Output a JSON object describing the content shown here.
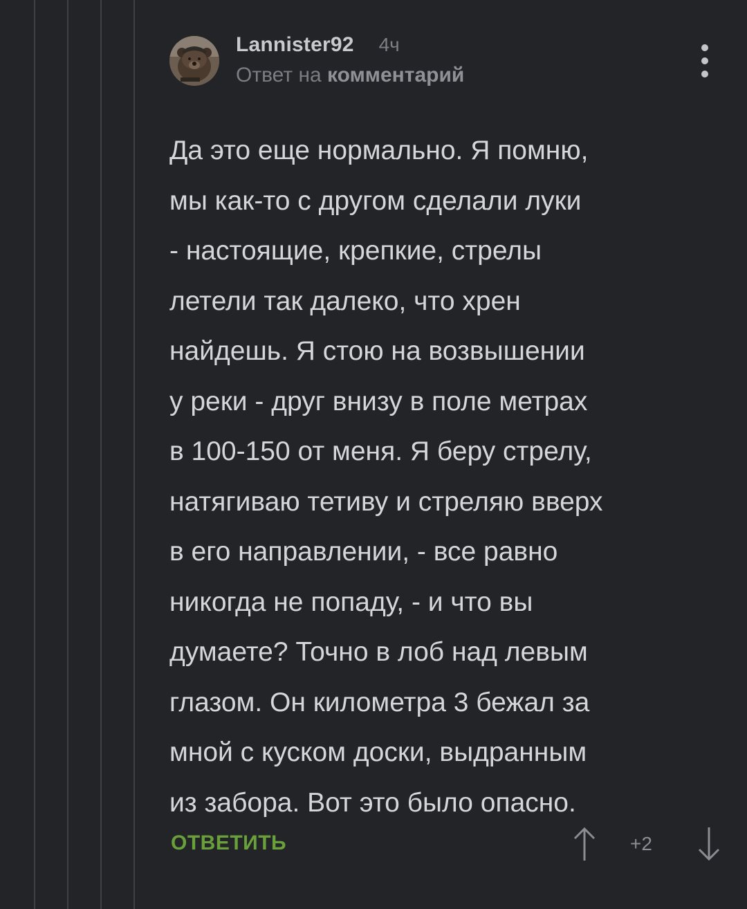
{
  "comment": {
    "username": "Lannister92",
    "time": "4ч",
    "reply_prefix": "Ответ на",
    "reply_link": "комментарий",
    "paragraph_lines": [
      "Да это еще нормально. Я помню,",
      "мы как-то с другом сделали луки",
      "- настоящие, крепкие, стрелы",
      "летели так далеко, что хрен",
      "найдешь. Я стою на возвышении",
      "у реки - друг внизу в поле метрах",
      "в 100-150 от меня. Я беру стрелу,",
      "натягиваю тетиву и стреляю вверх",
      "в его направлении, - все равно",
      "никогда не попаду, - и что вы",
      "думаете? Точно в лоб над левым",
      "глазом. Он километра 3 бежал за",
      "мной с куском доски, выдранным",
      "из забора. Вот это было опасно."
    ],
    "reply_button": "ОТВЕТИТЬ",
    "score": "+2"
  },
  "icons": {
    "menu": "more-vertical-icon",
    "upvote": "arrow-up-icon",
    "downvote": "arrow-down-icon"
  },
  "colors": {
    "background": "#222427",
    "thread_line": "#3e4146",
    "accent_green": "#6aa03b"
  }
}
